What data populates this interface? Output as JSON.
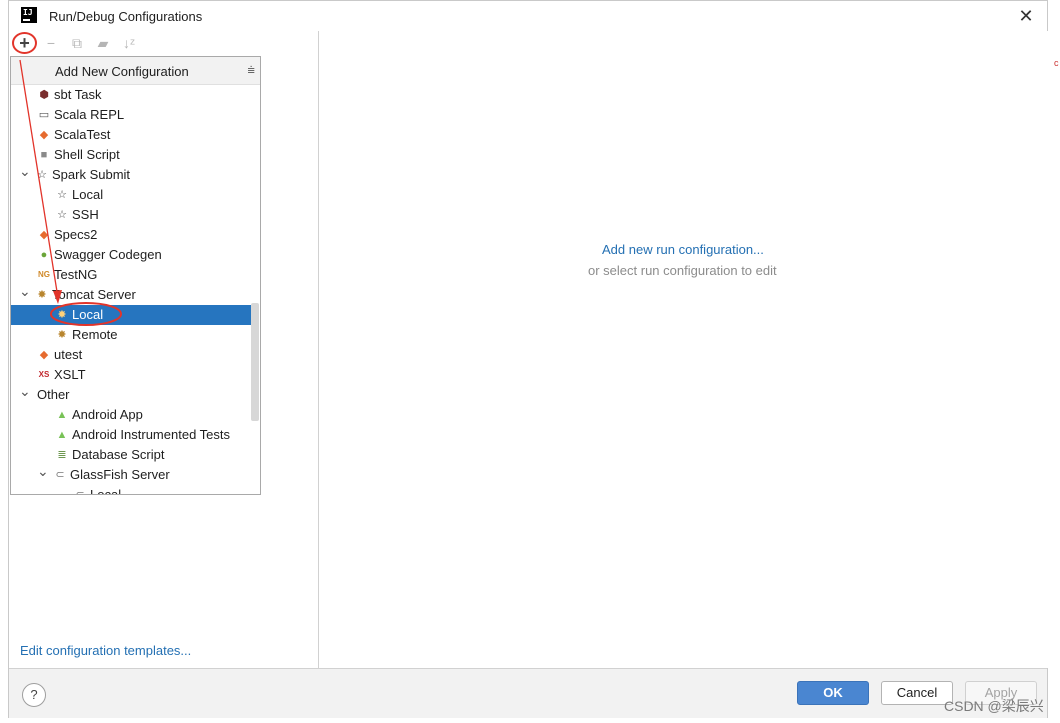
{
  "window": {
    "title": "Run/Debug Configurations",
    "app_icon_text": "IJ"
  },
  "toolbar": {
    "add": "+",
    "remove": "−",
    "copy": "⧉",
    "folder": "▰",
    "sort": "↓ᶻ"
  },
  "popup": {
    "title": "Add New Configuration",
    "items": [
      {
        "label": "sbt Task",
        "icon": "sbt-icon",
        "glyph": "⬢",
        "color": "#7a2e2e",
        "level": 1
      },
      {
        "label": "Scala REPL",
        "icon": "scala-repl-icon",
        "glyph": "▭",
        "color": "#555555",
        "level": 1
      },
      {
        "label": "ScalaTest",
        "icon": "scalatest-icon",
        "glyph": "◆",
        "color": "#e66b2f",
        "level": 1
      },
      {
        "label": "Shell Script",
        "icon": "shell-script-icon",
        "glyph": "■",
        "color": "#8a8a8a",
        "level": 1
      },
      {
        "label": "Spark Submit",
        "icon": "spark-icon",
        "glyph": "☆",
        "color": "#444444",
        "level": 0,
        "expanded": true
      },
      {
        "label": "Local",
        "icon": "spark-local-icon",
        "glyph": "☆",
        "color": "#444444",
        "level": 2
      },
      {
        "label": "SSH",
        "icon": "spark-ssh-icon",
        "glyph": "☆",
        "color": "#444444",
        "level": 2
      },
      {
        "label": "Specs2",
        "icon": "specs2-icon",
        "glyph": "◆",
        "color": "#e66b2f",
        "level": 1
      },
      {
        "label": "Swagger Codegen",
        "icon": "swagger-icon",
        "glyph": "●",
        "color": "#6ba539",
        "level": 1
      },
      {
        "label": "TestNG",
        "icon": "testng-icon",
        "glyph": "NG",
        "color": "#d08a2a",
        "level": 1
      },
      {
        "label": "Tomcat Server",
        "icon": "tomcat-icon",
        "glyph": "✸",
        "color": "#b8862f",
        "level": 0,
        "expanded": true
      },
      {
        "label": "Local",
        "icon": "tomcat-local-icon",
        "glyph": "✸",
        "color": "#ffd27a",
        "level": 2,
        "selected": true
      },
      {
        "label": "Remote",
        "icon": "tomcat-remote-icon",
        "glyph": "✸",
        "color": "#b8862f",
        "level": 2
      },
      {
        "label": "utest",
        "icon": "utest-icon",
        "glyph": "◆",
        "color": "#e66b2f",
        "level": 1
      },
      {
        "label": "XSLT",
        "icon": "xslt-icon",
        "glyph": "XS",
        "color": "#c1272d",
        "level": 1
      },
      {
        "label": "Other",
        "icon": "",
        "glyph": "",
        "color": "#444444",
        "level": -1,
        "expanded": true
      },
      {
        "label": "Android App",
        "icon": "android-icon",
        "glyph": "▲",
        "color": "#78c257",
        "level": 2
      },
      {
        "label": "Android Instrumented Tests",
        "icon": "android-test-icon",
        "glyph": "▲",
        "color": "#78c257",
        "level": 2
      },
      {
        "label": "Database Script",
        "icon": "database-script-icon",
        "glyph": "≣",
        "color": "#5b8a3a",
        "level": 2
      },
      {
        "label": "GlassFish Server",
        "icon": "glassfish-icon",
        "glyph": "⊂",
        "color": "#777777",
        "level": 1,
        "expanded": true
      },
      {
        "label": "Local",
        "icon": "glassfish-local-icon",
        "glyph": "⊂",
        "color": "#777777",
        "level": 3
      }
    ]
  },
  "left_footer": {
    "edit_templates": "Edit configuration templates..."
  },
  "right_pane": {
    "add_link": "Add new run configuration...",
    "hint": "or select run configuration to edit"
  },
  "footer": {
    "help": "?",
    "ok": "OK",
    "cancel": "Cancel",
    "apply": "Apply"
  },
  "watermark": "CSDN @梁辰兴",
  "colors": {
    "selection": "#2675bf",
    "link": "#2470b3",
    "ok_button": "#4a86d1",
    "annotation": "#e2342a"
  }
}
